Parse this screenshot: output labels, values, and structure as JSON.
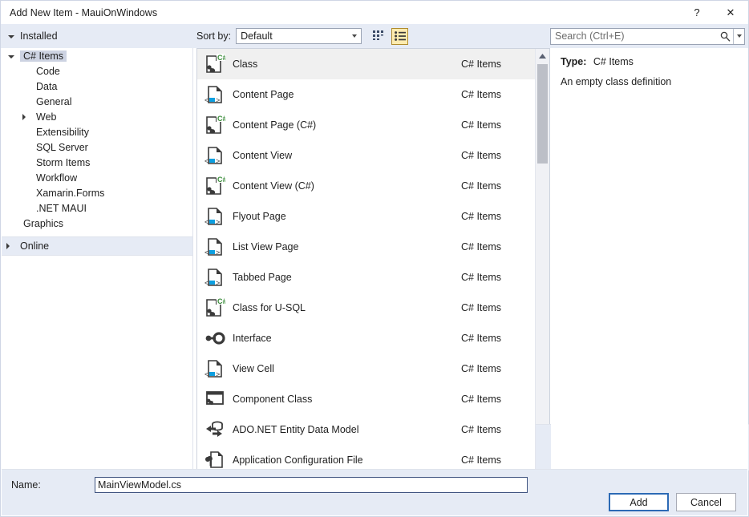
{
  "window": {
    "title": "Add New Item - MauiOnWindows",
    "help_button": "?",
    "close_button": "✕"
  },
  "toolbar": {
    "installed_label": "Installed",
    "sort_by_label": "Sort by:",
    "sort_by_value": "Default",
    "view_medium_icons": "medium-icons-view",
    "view_list": "list-view",
    "search_placeholder": "Search (Ctrl+E)",
    "search_value": ""
  },
  "tree": {
    "root": {
      "label": "C# Items",
      "selected": true
    },
    "children": [
      {
        "label": "Code",
        "expandable": false
      },
      {
        "label": "Data",
        "expandable": false
      },
      {
        "label": "General",
        "expandable": false
      },
      {
        "label": "Web",
        "expandable": true
      },
      {
        "label": "Extensibility",
        "expandable": false
      },
      {
        "label": "SQL Server",
        "expandable": false
      },
      {
        "label": "Storm Items",
        "expandable": false
      },
      {
        "label": "Workflow",
        "expandable": false
      },
      {
        "label": "Xamarin.Forms",
        "expandable": false
      },
      {
        "label": ".NET MAUI",
        "expandable": false
      }
    ],
    "graphics": {
      "label": "Graphics"
    },
    "online": {
      "label": "Online",
      "expandable": true
    }
  },
  "list": {
    "items": [
      {
        "name": "Class",
        "category": "C# Items",
        "icon": "csharp-class-icon",
        "selected": true
      },
      {
        "name": "Content Page",
        "category": "C# Items",
        "icon": "xaml-file-icon",
        "selected": false
      },
      {
        "name": "Content Page (C#)",
        "category": "C# Items",
        "icon": "csharp-class-icon",
        "selected": false
      },
      {
        "name": "Content View",
        "category": "C# Items",
        "icon": "xaml-file-icon",
        "selected": false
      },
      {
        "name": "Content View (C#)",
        "category": "C# Items",
        "icon": "csharp-class-icon",
        "selected": false
      },
      {
        "name": "Flyout Page",
        "category": "C# Items",
        "icon": "xaml-file-icon",
        "selected": false
      },
      {
        "name": "List View Page",
        "category": "C# Items",
        "icon": "xaml-file-icon",
        "selected": false
      },
      {
        "name": "Tabbed Page",
        "category": "C# Items",
        "icon": "xaml-file-icon",
        "selected": false
      },
      {
        "name": "Class for U-SQL",
        "category": "C# Items",
        "icon": "csharp-class-icon",
        "selected": false
      },
      {
        "name": "Interface",
        "category": "C# Items",
        "icon": "interface-icon",
        "selected": false
      },
      {
        "name": "View Cell",
        "category": "C# Items",
        "icon": "xaml-file-icon",
        "selected": false
      },
      {
        "name": "Component Class",
        "category": "C# Items",
        "icon": "component-class-icon",
        "selected": false
      },
      {
        "name": "ADO.NET Entity Data Model",
        "category": "C# Items",
        "icon": "database-model-icon",
        "selected": false
      },
      {
        "name": "Application Configuration File",
        "category": "C# Items",
        "icon": "config-file-icon",
        "selected": false
      }
    ],
    "scroll_thumb_top_pct": 4,
    "scroll_thumb_height_pct": 24
  },
  "detail": {
    "type_label": "Type:",
    "type_value": "C# Items",
    "description": "An empty class definition"
  },
  "footer": {
    "name_label": "Name:",
    "name_value": "MainViewModel.cs",
    "add_label": "Add",
    "cancel_label": "Cancel"
  },
  "colors": {
    "toolbar_bg": "#e6ebf5",
    "selection_bg": "#f0f0f0",
    "tree_selection_bg": "#cdd3e2",
    "active_toggle_bg": "#fdebaf",
    "active_toggle_border": "#b08b2e",
    "primary_border": "#2c6ab5",
    "csharp_badge": "#3a8c3a",
    "xaml_tag": "#0d9fe0"
  }
}
